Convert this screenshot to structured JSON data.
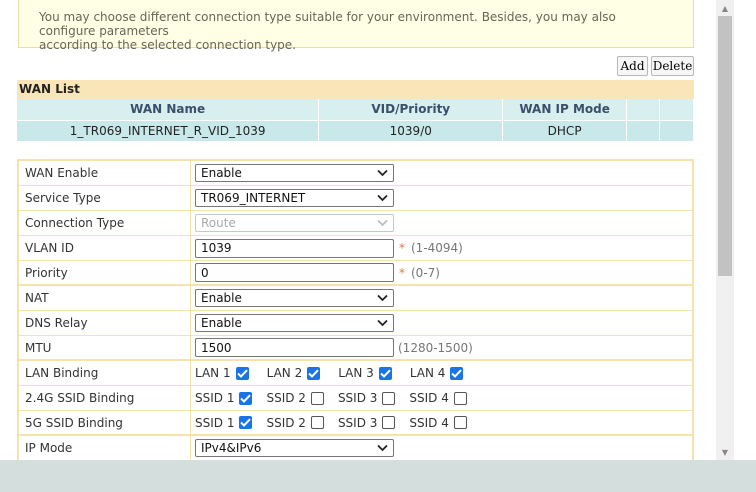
{
  "notice": {
    "line1": "You may choose different connection type suitable for your environment. Besides, you may also configure parameters",
    "line2": "according to the selected connection type."
  },
  "toolbar": {
    "add_label": "Add",
    "delete_label": "Delete"
  },
  "wan_list": {
    "title": "WAN List",
    "columns": [
      "WAN Name",
      "VID/Priority",
      "WAN IP Mode"
    ],
    "rows": [
      {
        "name": "1_TR069_INTERNET_R_VID_1039",
        "vid_priority": "1039/0",
        "ip_mode": "DHCP"
      }
    ]
  },
  "form": {
    "wan_enable": {
      "label": "WAN Enable",
      "value": "Enable"
    },
    "service_type": {
      "label": "Service Type",
      "value": "TR069_INTERNET"
    },
    "connection_type": {
      "label": "Connection Type",
      "value": "Route"
    },
    "vlan_id": {
      "label": "VLAN ID",
      "value": "1039",
      "required": "*",
      "hint": "(1-4094)"
    },
    "priority": {
      "label": "Priority",
      "value": "0",
      "required": "*",
      "hint": "(0-7)"
    },
    "nat": {
      "label": "NAT",
      "value": "Enable"
    },
    "dns_relay": {
      "label": "DNS Relay",
      "value": "Enable"
    },
    "mtu": {
      "label": "MTU",
      "value": "1500",
      "hint": "(1280-1500)"
    },
    "lan_binding": {
      "label": "LAN Binding",
      "items": [
        {
          "label": "LAN 1",
          "checked": true
        },
        {
          "label": "LAN 2",
          "checked": true
        },
        {
          "label": "LAN 3",
          "checked": true
        },
        {
          "label": "LAN 4",
          "checked": true
        }
      ]
    },
    "ssid_24g": {
      "label": "2.4G SSID Binding",
      "items": [
        {
          "label": "SSID 1",
          "checked": true
        },
        {
          "label": "SSID 2",
          "checked": false
        },
        {
          "label": "SSID 3",
          "checked": false
        },
        {
          "label": "SSID 4",
          "checked": false
        }
      ]
    },
    "ssid_5g": {
      "label": "5G SSID Binding",
      "items": [
        {
          "label": "SSID 1",
          "checked": true
        },
        {
          "label": "SSID 2",
          "checked": false
        },
        {
          "label": "SSID 3",
          "checked": false
        },
        {
          "label": "SSID 4",
          "checked": false
        }
      ]
    },
    "ip_mode": {
      "label": "IP Mode",
      "value": "IPv4&IPv6"
    }
  },
  "colors": {
    "notice_bg": "#ffffe6",
    "table_header_bg": "#d7efef",
    "table_row_bg": "#c9e8ea",
    "wan_list_title_bg": "#f9e5b8",
    "checkbox_checked": "#1b73e8",
    "required_star": "#e07a3b"
  }
}
